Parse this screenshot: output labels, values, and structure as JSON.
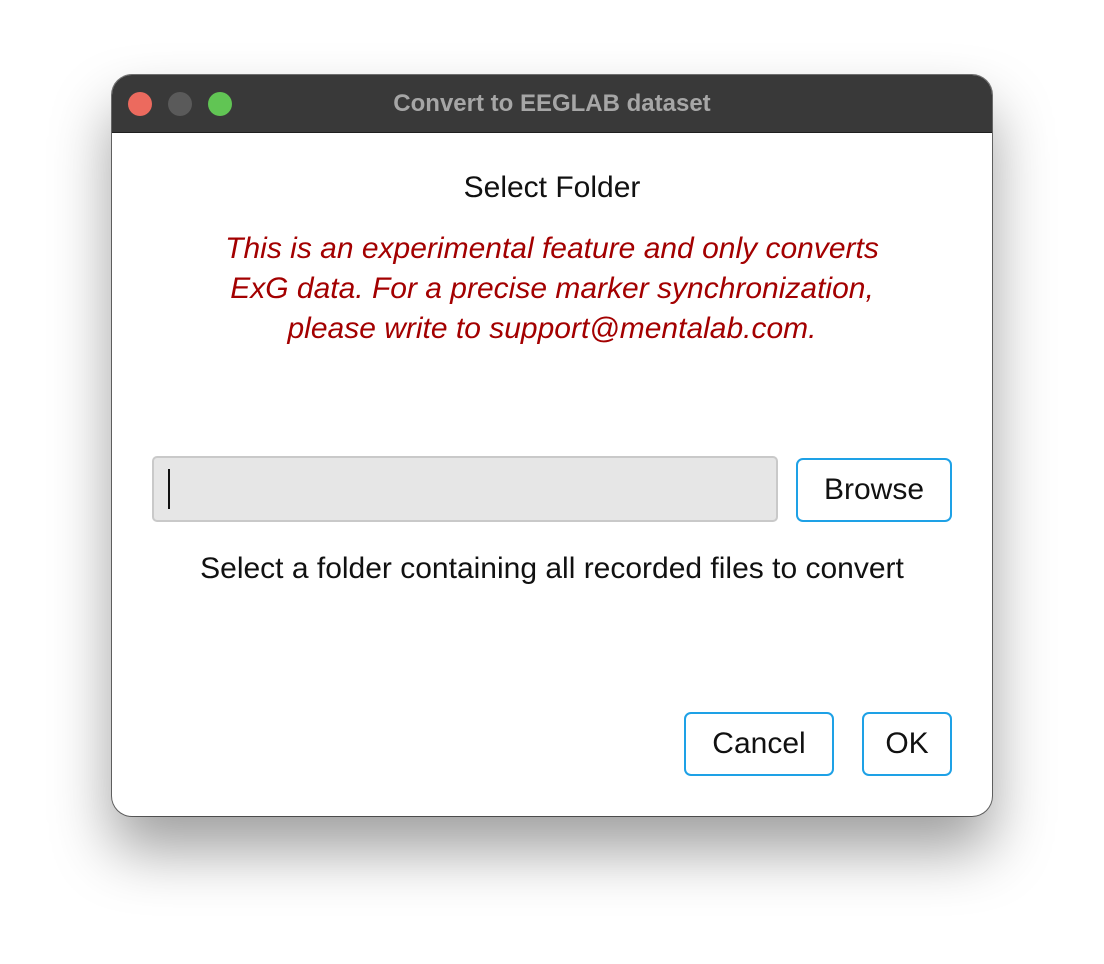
{
  "window": {
    "title": "Convert to EEGLAB dataset"
  },
  "dialog": {
    "heading": "Select Folder",
    "warning_lines": [
      "This is an experimental feature and only converts",
      "ExG data. For a precise marker synchronization,",
      "please write to support@mentalab.com."
    ],
    "path_input": {
      "value": "",
      "placeholder": ""
    },
    "browse_label": "Browse",
    "hint": "Select a folder containing all recorded files to convert",
    "cancel_label": "Cancel",
    "ok_label": "OK"
  },
  "colors": {
    "warning": "#a30000",
    "accent": "#1ea1e6",
    "titlebar": "#393939",
    "close": "#ec6a5e",
    "minimize": "#5a5a5a",
    "zoom": "#61c554"
  }
}
